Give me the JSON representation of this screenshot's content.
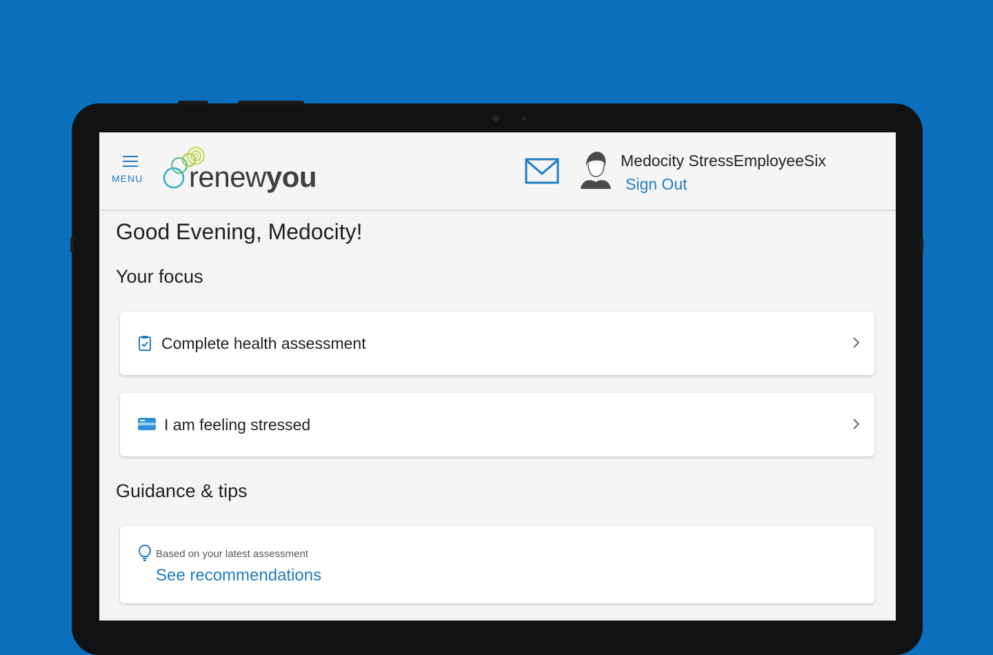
{
  "header": {
    "menu_label": "MENU",
    "logo": {
      "part1": "renew",
      "part2": "you"
    },
    "user_name": "Medocity StressEmployeeSix",
    "sign_out": "Sign Out"
  },
  "main": {
    "greeting": "Good Evening, Medocity!",
    "focus": {
      "title": "Your focus",
      "items": [
        {
          "label": "Complete health assessment",
          "icon": "clipboard-check-icon"
        },
        {
          "label": "I am feeling stressed",
          "icon": "id-card-icon"
        }
      ]
    },
    "guidance": {
      "title": "Guidance & tips",
      "tip": {
        "subtitle": "Based on your latest assessment",
        "link": "See recommendations",
        "icon": "lightbulb-icon"
      }
    }
  },
  "colors": {
    "background": "#0a6fbd",
    "accent": "#1e7bc4",
    "screen": "#f4f4f4"
  }
}
